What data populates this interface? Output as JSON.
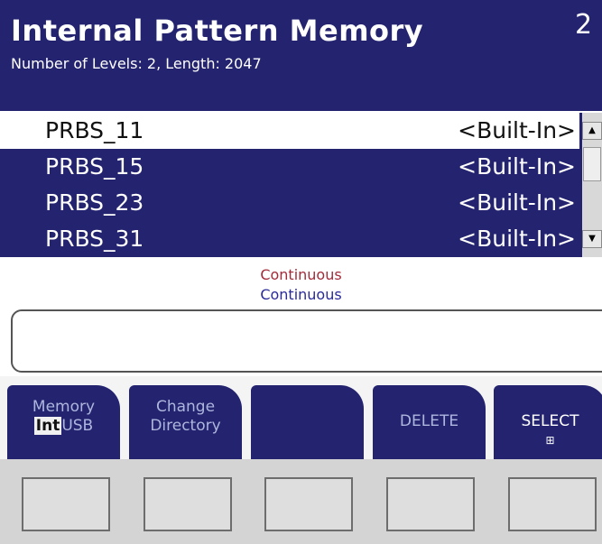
{
  "header": {
    "title": "Internal Pattern Memory",
    "subtitle": "Number of Levels: 2, Length: 2047",
    "corner_text": "2"
  },
  "patterns": [
    {
      "name": "PRBS_11",
      "tag": "<Built-In>",
      "selected": true
    },
    {
      "name": "PRBS_15",
      "tag": "<Built-In>",
      "selected": false
    },
    {
      "name": "PRBS_23",
      "tag": "<Built-In>",
      "selected": false
    },
    {
      "name": "PRBS_31",
      "tag": "<Built-In>",
      "selected": false
    }
  ],
  "scrollbar": {
    "up_icon": "up-arrow-icon",
    "down_icon": "down-arrow-icon"
  },
  "status": {
    "line1": "Continuous",
    "line2": "Continuous"
  },
  "message_box": {
    "text": ""
  },
  "softkeys": {
    "memory": {
      "label": "Memory",
      "int": "Int",
      "usb": "USB"
    },
    "change_directory": {
      "line1": "Change",
      "line2": "Directory"
    },
    "blank": {
      "label": ""
    },
    "delete": {
      "label": "DELETE"
    },
    "select": {
      "label": "SELECT",
      "icon": "menu-grid-icon"
    }
  },
  "colors": {
    "header_bg": "#23236f",
    "list_bg": "#23236f",
    "selected_row_bg": "#ffffff",
    "status_red": "#a32b3a",
    "status_blue": "#2a2a9a"
  }
}
